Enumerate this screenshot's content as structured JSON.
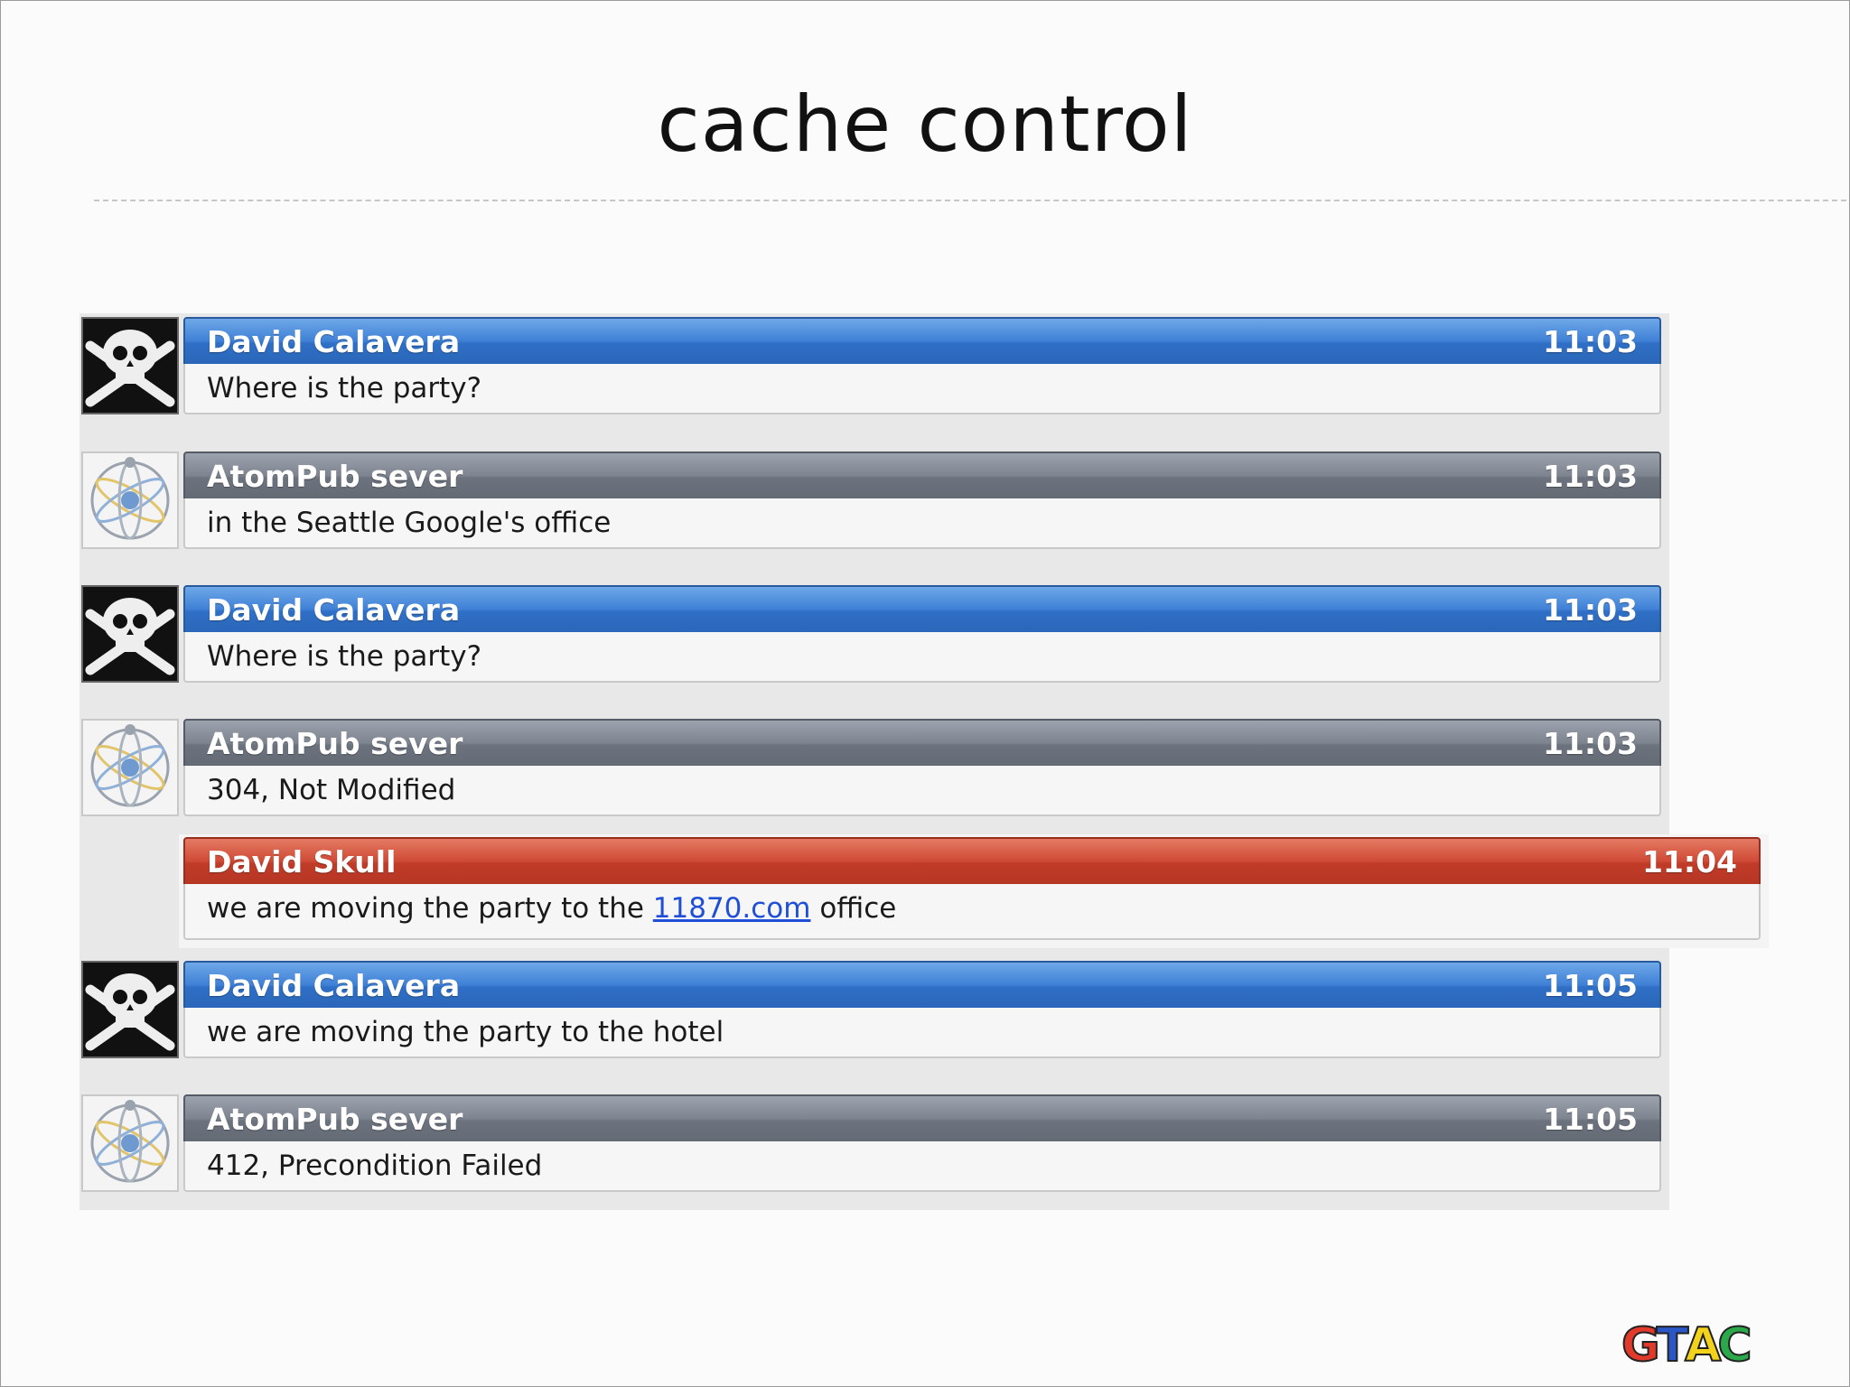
{
  "slide": {
    "title": "cache control"
  },
  "colors": {
    "blue_header": "#3e80d6",
    "gray_header": "#7d848f",
    "red_header": "#cf4a35",
    "link": "#1f4fd6"
  },
  "messages": [
    {
      "avatar": "skull-crossbones-icon",
      "sender": "David Calavera",
      "time": "11:03",
      "text": "Where is the party?",
      "style": "blue"
    },
    {
      "avatar": "atom-icon",
      "sender": "AtomPub sever",
      "time": "11:03",
      "text": "in the Seattle Google's office",
      "style": "gray"
    },
    {
      "avatar": "skull-crossbones-icon",
      "sender": "David Calavera",
      "time": "11:03",
      "text": "Where is the party?",
      "style": "blue"
    },
    {
      "avatar": "atom-icon",
      "sender": "AtomPub sever",
      "time": "11:03",
      "text": "304, Not Modified",
      "style": "gray"
    },
    {
      "avatar": "",
      "sender": "David Skull",
      "time": "11:04",
      "text_before": "we are moving the party to the ",
      "link": "11870.com",
      "text_after": " office",
      "style": "red"
    },
    {
      "avatar": "skull-crossbones-icon",
      "sender": "David Calavera",
      "time": "11:05",
      "text": "we are moving the party to the hotel",
      "style": "blue"
    },
    {
      "avatar": "atom-icon",
      "sender": "AtomPub sever",
      "time": "11:05",
      "text": "412, Precondition Failed",
      "style": "gray"
    }
  ],
  "logo": {
    "letters": [
      "G",
      "T",
      "A",
      "C"
    ],
    "letter_colors": [
      "#e23a2a",
      "#2a56c6",
      "#f2d21a",
      "#2aa84a"
    ]
  }
}
